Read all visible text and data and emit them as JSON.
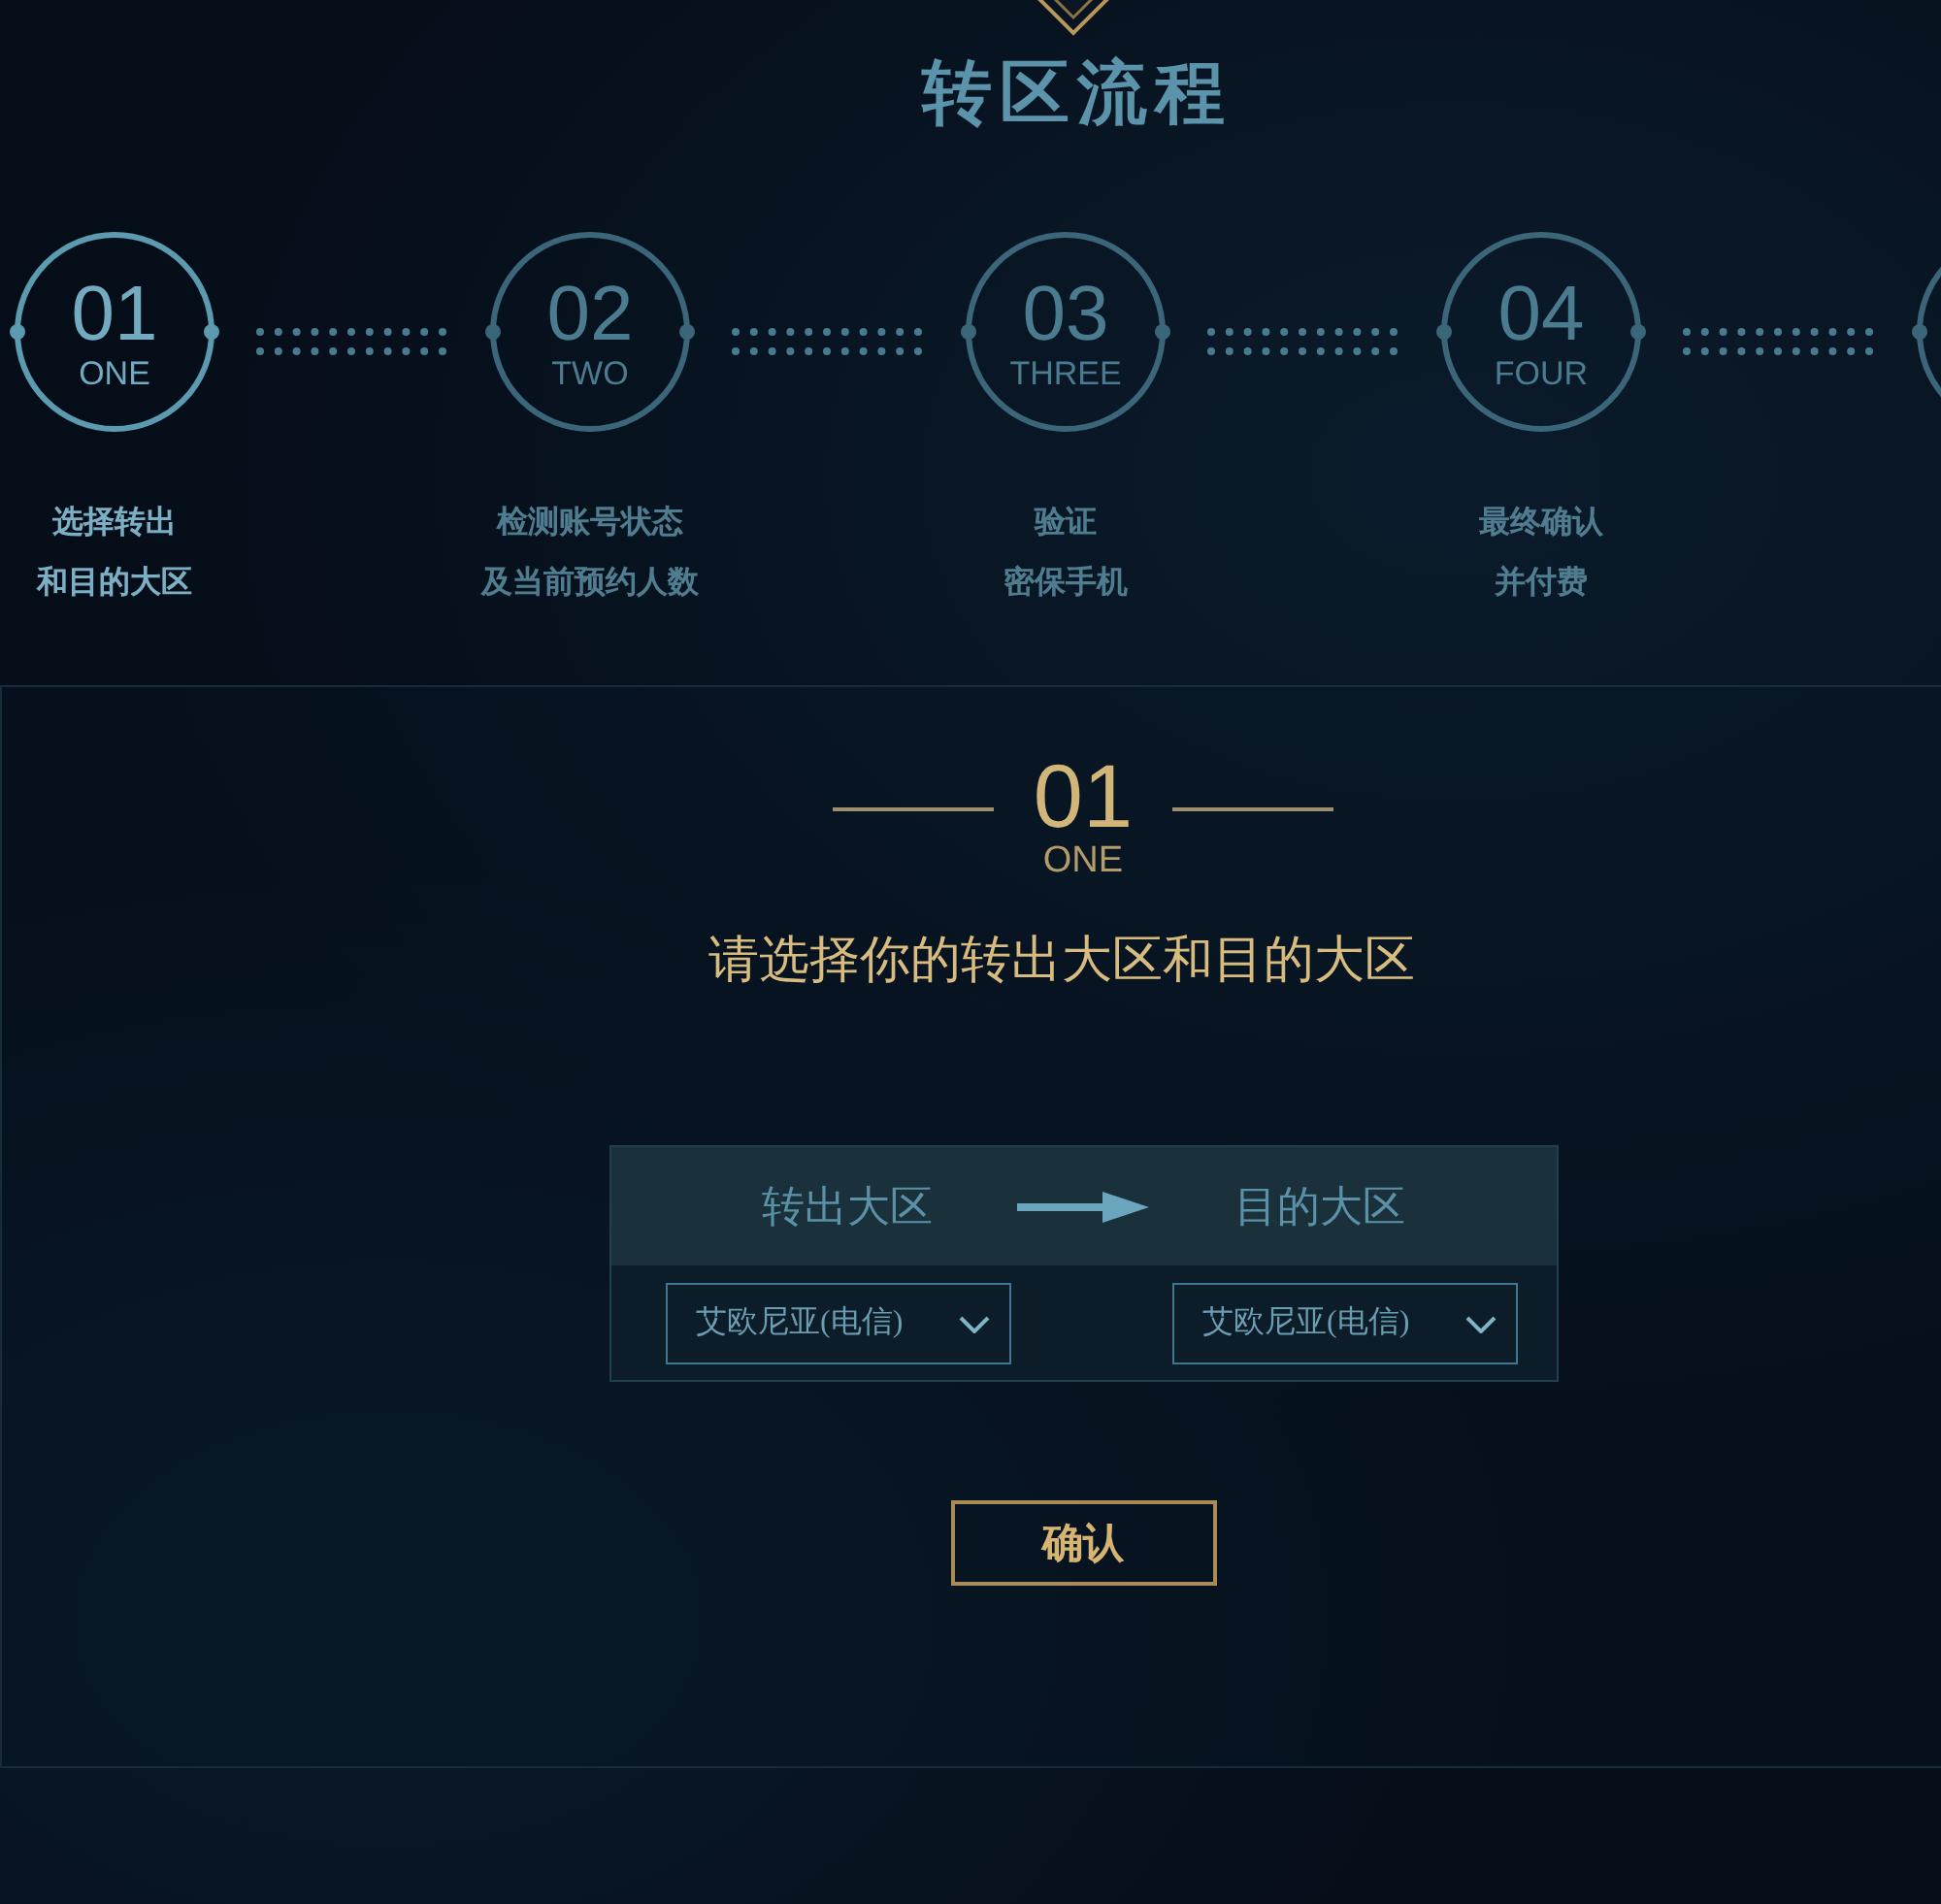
{
  "header": {
    "title": "转区流程"
  },
  "steps": [
    {
      "number": "01",
      "word": "ONE",
      "label": [
        "选择转出",
        "和目的大区"
      ],
      "selected": true
    },
    {
      "number": "02",
      "word": "TWO",
      "label": [
        "检测账号状态",
        "及当前预约人数"
      ],
      "selected": false
    },
    {
      "number": "03",
      "word": "THREE",
      "label": [
        "验证",
        "密保手机"
      ],
      "selected": false
    },
    {
      "number": "04",
      "word": "FOUR",
      "label": [
        "最终确认",
        "并付费"
      ],
      "selected": false
    },
    {
      "selected": false
    }
  ],
  "current_step": {
    "number": "01",
    "word": "ONE",
    "instruction": "请选择你的转出大区和目的大区"
  },
  "region_form": {
    "from_label": "转出大区",
    "to_label": "目的大区",
    "from_select": {
      "value": "艾欧尼亚(电信)"
    },
    "to_select": {
      "value": "艾欧尼亚(电信)"
    }
  },
  "confirm_button": {
    "label": "确认"
  }
}
